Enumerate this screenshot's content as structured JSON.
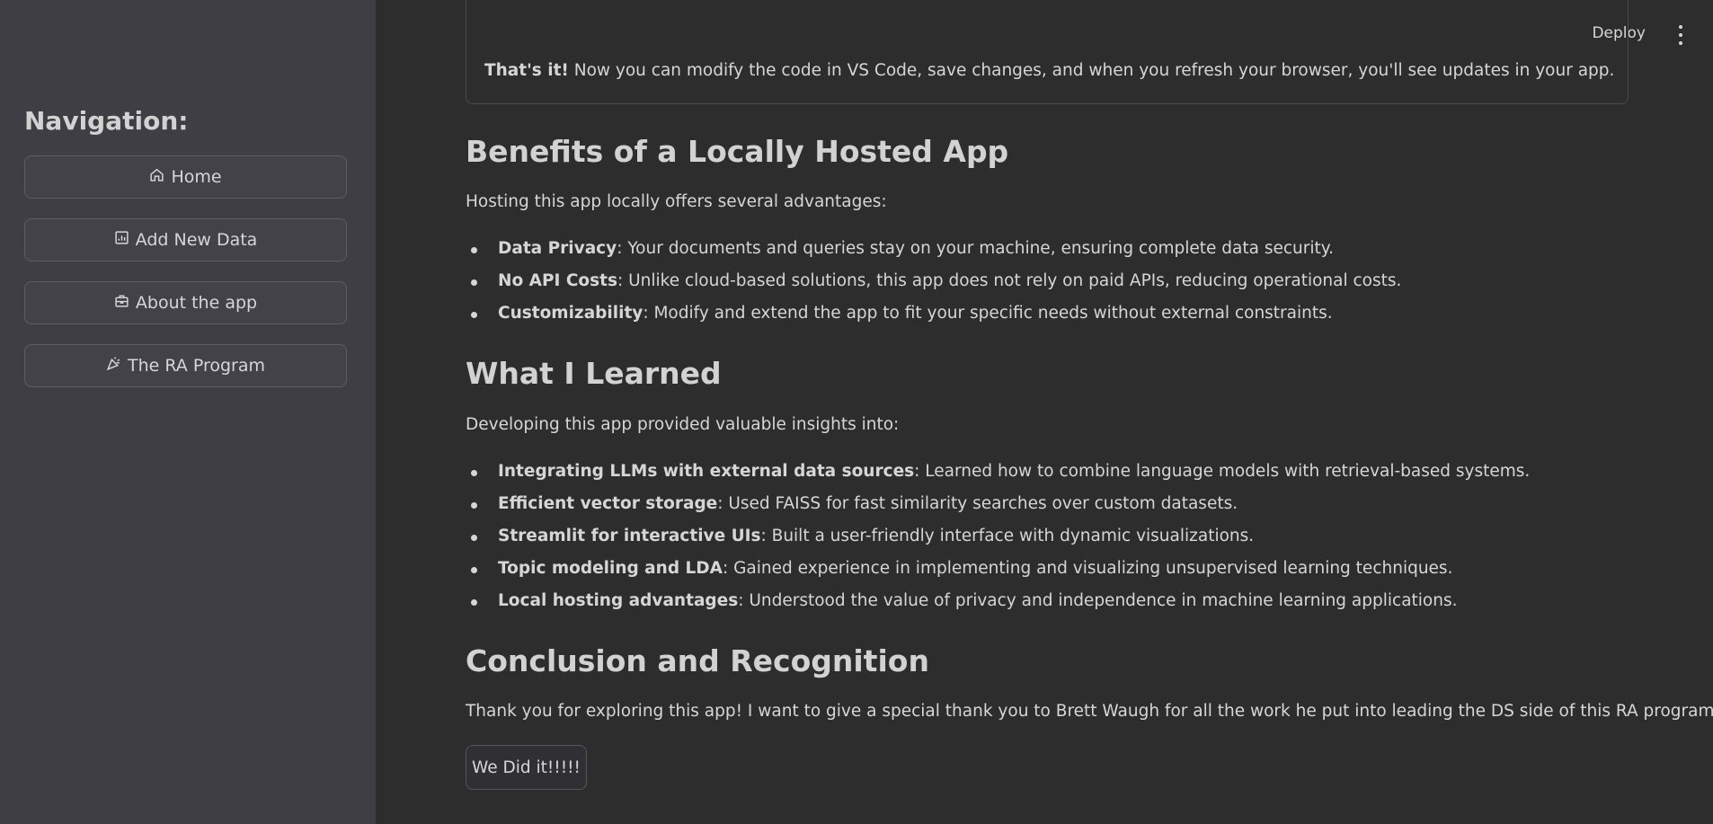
{
  "sidebar": {
    "title": "Navigation:",
    "items": [
      {
        "label": "Home",
        "icon": "home-icon"
      },
      {
        "label": "Add New Data",
        "icon": "chart-icon"
      },
      {
        "label": "About the app",
        "icon": "briefcase-icon"
      },
      {
        "label": "The RA Program",
        "icon": "party-icon"
      }
    ]
  },
  "header": {
    "deploy_label": "Deploy",
    "menu_icon": "more-vert-icon"
  },
  "callout": {
    "bold": "That's it!",
    "text": " Now you can modify the code in VS Code, save changes, and when you refresh your browser, you'll see updates in your app."
  },
  "sections": {
    "benefits": {
      "heading": "Benefits of a Locally Hosted App",
      "intro": "Hosting this app locally offers several advantages:",
      "items": [
        {
          "bold": "Data Privacy",
          "text": ": Your documents and queries stay on your machine, ensuring complete data security."
        },
        {
          "bold": "No API Costs",
          "text": ": Unlike cloud-based solutions, this app does not rely on paid APIs, reducing operational costs."
        },
        {
          "bold": "Customizability",
          "text": ": Modify and extend the app to fit your specific needs without external constraints."
        }
      ]
    },
    "learned": {
      "heading": "What I Learned",
      "intro": "Developing this app provided valuable insights into:",
      "items": [
        {
          "bold": "Integrating LLMs with external data sources",
          "text": ": Learned how to combine language models with retrieval-based systems."
        },
        {
          "bold": "Efficient vector storage",
          "text": ": Used FAISS for fast similarity searches over custom datasets."
        },
        {
          "bold": "Streamlit for interactive UIs",
          "text": ": Built a user-friendly interface with dynamic visualizations."
        },
        {
          "bold": "Topic modeling and LDA",
          "text": ": Gained experience in implementing and visualizing unsupervised learning techniques."
        },
        {
          "bold": "Local hosting advantages",
          "text": ": Understood the value of privacy and independence in machine learning applications."
        }
      ]
    },
    "conclusion": {
      "heading": "Conclusion and Recognition",
      "text": "Thank you for exploring this app! I want to give a special thank you to Brett Waugh for all the work he put into leading the DS side of this RA program.",
      "button_label": "We Did it!!!!!"
    }
  },
  "colors": {
    "main_bg": "#2d2d2d",
    "sidebar_bg": "#3e3e44",
    "text": "#d6d6d6"
  }
}
